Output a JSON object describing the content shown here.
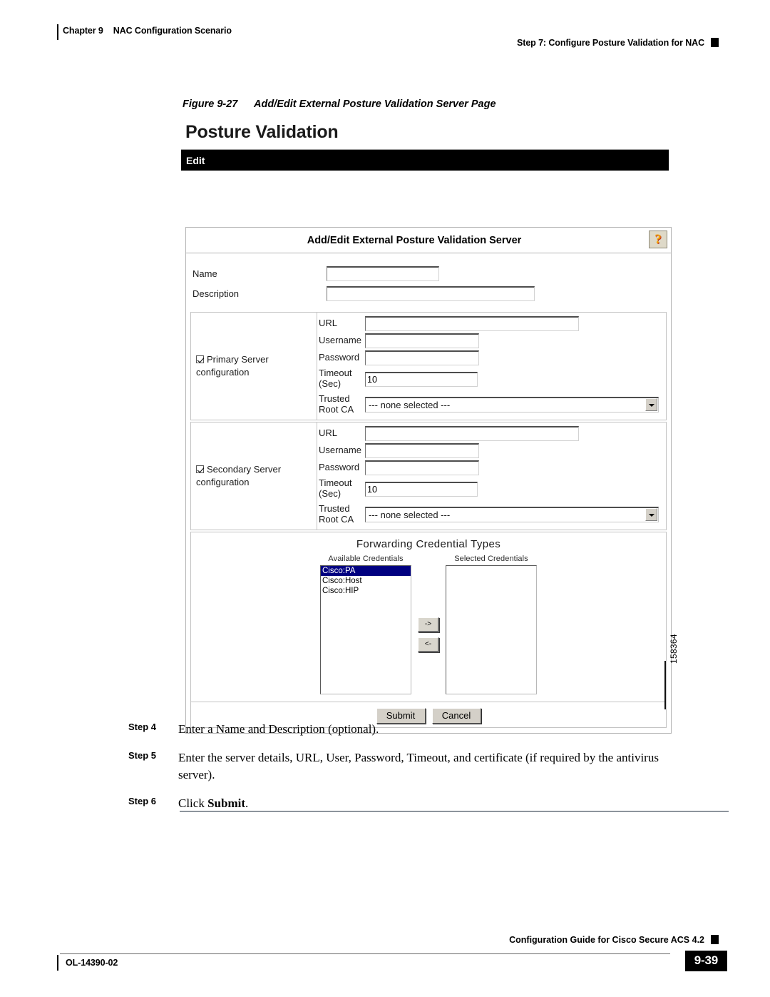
{
  "header": {
    "chapter": "Chapter 9",
    "chapter_title": "NAC Configuration Scenario",
    "step_title": "Step 7: Configure Posture Validation for NAC"
  },
  "figure": {
    "number": "Figure 9-27",
    "title": "Add/Edit External Posture Validation Server Page",
    "figure_id": "158364"
  },
  "screenshot": {
    "app_title": "Posture Validation",
    "nav_bar_label": "Edit",
    "panel": {
      "title": "Add/Edit External Posture Validation Server",
      "help_icon": "help-question-icon",
      "help_glyph": "?",
      "fields": {
        "name_label": "Name",
        "name_value": "",
        "description_label": "Description",
        "description_value": ""
      },
      "primary": {
        "checkbox_label": "Primary Server configuration",
        "checkbox_checked": true,
        "url_label": "URL",
        "url_value": "",
        "username_label": "Username",
        "username_value": "",
        "password_label": "Password",
        "password_value": "",
        "timeout_label": "Timeout (Sec)",
        "timeout_value": "10",
        "trusted_label": "Trusted Root CA",
        "trusted_value": "--- none selected ---"
      },
      "secondary": {
        "checkbox_label": "Secondary Server configuration",
        "checkbox_checked": true,
        "url_label": "URL",
        "url_value": "",
        "username_label": "Username",
        "username_value": "",
        "password_label": "Password",
        "password_value": "",
        "timeout_label": "Timeout (Sec)",
        "timeout_value": "10",
        "trusted_label": "Trusted Root CA",
        "trusted_value": "--- none selected ---"
      },
      "forwarding": {
        "title": "Forwarding Credential Types",
        "available_label": "Available Credentials",
        "available_items": [
          "Cisco:PA",
          "Cisco:Host",
          "Cisco:HIP"
        ],
        "available_selected_index": 0,
        "selected_label": "Selected Credentials",
        "selected_items": [],
        "add_button": "->",
        "remove_button": "<-"
      },
      "buttons": {
        "submit": "Submit",
        "cancel": "Cancel"
      }
    }
  },
  "steps": [
    {
      "label": "Step 4",
      "text": "Enter a Name and Description (optional)."
    },
    {
      "label": "Step 5",
      "text": "Enter the server details, URL, User, Password, Timeout, and certificate (if required by the antivirus server)."
    },
    {
      "label": "Step 6",
      "text_prefix": "Click ",
      "bold": "Submit",
      "text_suffix": "."
    }
  ],
  "footer": {
    "guide_title": "Configuration Guide for Cisco Secure ACS 4.2",
    "doc_id": "OL-14390-02",
    "page_number": "9-39"
  },
  "colors": {
    "nav_bar": "#000000",
    "list_selection": "#000080",
    "help_icon_bg": "#ded9c8",
    "button_face": "#d4d0c8"
  }
}
